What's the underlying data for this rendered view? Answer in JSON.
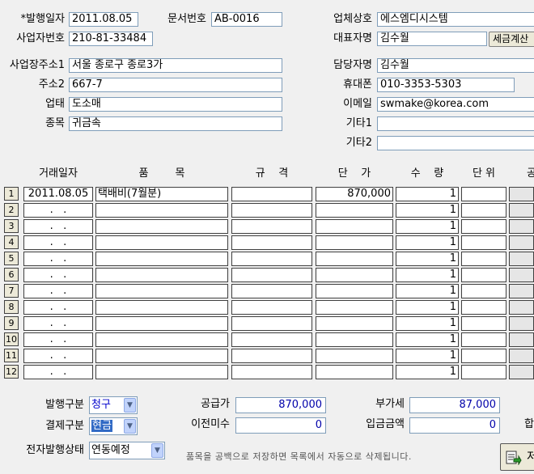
{
  "header": {
    "issue_date_label": "*발행일자",
    "issue_date": "2011.08.05",
    "doc_no_label": "문서번호",
    "doc_no": "AB-0016",
    "company_label": "업체상호",
    "company": "에스엠디시스템",
    "biz_no_label": "사업자번호",
    "biz_no": "210-81-33484",
    "ceo_label": "대표자명",
    "ceo": "김수월",
    "tax_button": "세금계산",
    "addr1_label": "사업장주소1",
    "addr1": "서울 종로구 종로3가",
    "manager_label": "담당자명",
    "manager": "김수월",
    "addr2_label": "주소2",
    "addr2": "667-7",
    "mobile_label": "휴대폰",
    "mobile": "010-3353-5303",
    "biz_type_label": "업태",
    "biz_type": "도소매",
    "email_label": "이메일",
    "email": "swmake@korea.com",
    "item_type_label": "종목",
    "item_type": "귀금속",
    "etc1_label": "기타1",
    "etc1": "",
    "etc2_label": "기타2",
    "etc2": ""
  },
  "table": {
    "headers": {
      "date": "거래일자",
      "item": "품        목",
      "spec": "규    격",
      "price": "단    가",
      "qty": "수    량",
      "unit": "단 위",
      "supply": "공"
    },
    "rows": [
      {
        "no": "1",
        "date": "2011.08.05",
        "item": "택배비(7월분)",
        "spec": "",
        "price": "870,000",
        "qty": "1",
        "unit": ""
      },
      {
        "no": "2",
        "date": ".   .",
        "item": "",
        "spec": "",
        "price": "",
        "qty": "1",
        "unit": ""
      },
      {
        "no": "3",
        "date": ".   .",
        "item": "",
        "spec": "",
        "price": "",
        "qty": "1",
        "unit": ""
      },
      {
        "no": "4",
        "date": ".   .",
        "item": "",
        "spec": "",
        "price": "",
        "qty": "1",
        "unit": ""
      },
      {
        "no": "5",
        "date": ".   .",
        "item": "",
        "spec": "",
        "price": "",
        "qty": "1",
        "unit": ""
      },
      {
        "no": "6",
        "date": ".   .",
        "item": "",
        "spec": "",
        "price": "",
        "qty": "1",
        "unit": ""
      },
      {
        "no": "7",
        "date": ".   .",
        "item": "",
        "spec": "",
        "price": "",
        "qty": "1",
        "unit": ""
      },
      {
        "no": "8",
        "date": ".   .",
        "item": "",
        "spec": "",
        "price": "",
        "qty": "1",
        "unit": ""
      },
      {
        "no": "9",
        "date": ".   .",
        "item": "",
        "spec": "",
        "price": "",
        "qty": "1",
        "unit": ""
      },
      {
        "no": "10",
        "date": ".   .",
        "item": "",
        "spec": "",
        "price": "",
        "qty": "1",
        "unit": ""
      },
      {
        "no": "11",
        "date": ".   .",
        "item": "",
        "spec": "",
        "price": "",
        "qty": "1",
        "unit": ""
      },
      {
        "no": "12",
        "date": ".   .",
        "item": "",
        "spec": "",
        "price": "",
        "qty": "1",
        "unit": ""
      }
    ]
  },
  "footer": {
    "issue_type_label": "발행구분",
    "issue_type": "청구",
    "pay_type_label": "결제구분",
    "pay_type": "현금",
    "e_status_label": "전자발행상태",
    "e_status": "연동예정",
    "supply_label": "공급가",
    "supply": "870,000",
    "vat_label": "부가세",
    "vat": "87,000",
    "prev_unpaid_label": "이전미수",
    "prev_unpaid": "0",
    "deposit_label": "입금금액",
    "deposit": "0",
    "total_cut": "합",
    "note": "품목을 공백으로 저장하면 목록에서 자동으로 삭제됩니다.",
    "save_button": "저"
  }
}
